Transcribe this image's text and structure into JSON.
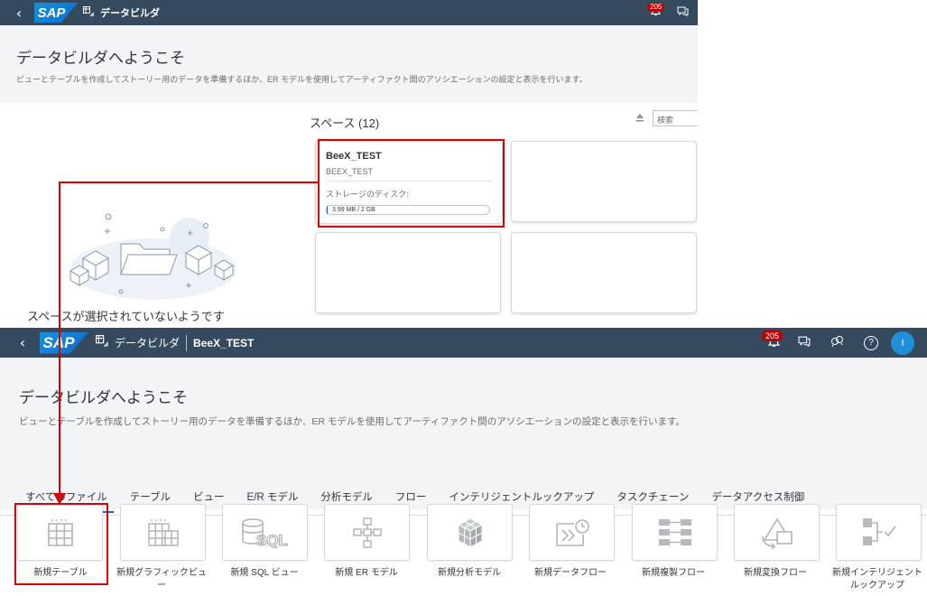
{
  "top": {
    "shell": {
      "back_icon": "‹",
      "logo": "SAP",
      "app_title": "データビルダ",
      "notification_count": "205"
    },
    "welcome": {
      "title": "データビルダへようこそ",
      "description": "ビューとテーブルを作成してストーリー用のデータを準備するほか、ER モデルを使用してアーティファクト間のアソシエーションの設定と表示を行います。"
    },
    "spaces": {
      "title": "スペース (12)",
      "search_placeholder": "検索",
      "cards": [
        {
          "name": "BeeX_TEST",
          "id": "BEEX_TEST",
          "storage_label": "ストレージのディスク:",
          "storage_value": "3.99 MB / 2 GB",
          "storage_fraction": 0.002
        }
      ]
    },
    "empty_state": "スペースが選択されていないようです"
  },
  "bottom": {
    "shell": {
      "back_icon": "‹",
      "logo": "SAP",
      "app_title": "データビルダ",
      "space_name": "BeeX_TEST",
      "notification_count": "205",
      "help_icon": "?",
      "avatar_initial": "I"
    },
    "welcome": {
      "title": "データビルダへようこそ",
      "description": "ビューとテーブルを作成してストーリー用のデータを準備するほか、ER モデルを使用してアーティファクト間のアソシエーションの設定と表示を行います。"
    },
    "tabs": [
      {
        "label": "すべてのファイル",
        "active": true
      },
      {
        "label": "テーブル"
      },
      {
        "label": "ビュー"
      },
      {
        "label": "E/R モデル"
      },
      {
        "label": "分析モデル"
      },
      {
        "label": "フロー"
      },
      {
        "label": "インテリジェントルックアップ"
      },
      {
        "label": "タスクチェーン"
      },
      {
        "label": "データアクセス制御"
      }
    ],
    "tiles": [
      {
        "label": "新規テーブル",
        "icon": "table-icon"
      },
      {
        "label": "新規グラフィックビュー",
        "icon": "graphical-view-icon"
      },
      {
        "label": "新規 SQL ビュー",
        "icon": "sql-view-icon"
      },
      {
        "label": "新規 ER モデル",
        "icon": "er-model-icon"
      },
      {
        "label": "新規分析モデル",
        "icon": "analytic-model-icon"
      },
      {
        "label": "新規データフロー",
        "icon": "data-flow-icon"
      },
      {
        "label": "新規複製フロー",
        "icon": "replication-flow-icon"
      },
      {
        "label": "新規変換フロー",
        "icon": "transformation-flow-icon"
      },
      {
        "label": "新規インテリジェントルックアップ",
        "icon": "intelligent-lookup-icon"
      }
    ]
  },
  "colors": {
    "shell_bg": "#354a5f",
    "accent": "#0a6ed1",
    "highlight": "#d40000",
    "welcome_bg": "#f2f4f7"
  }
}
